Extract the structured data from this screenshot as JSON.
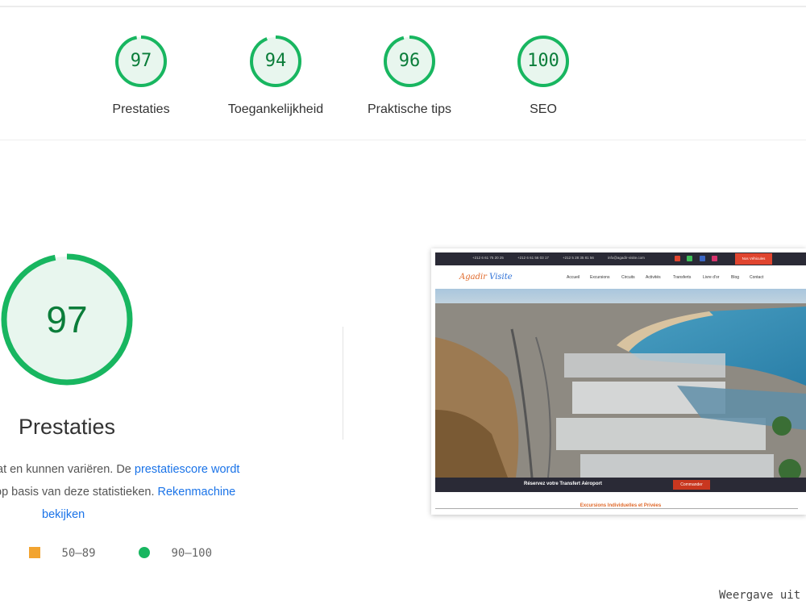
{
  "summary_gauges": [
    {
      "score": "97",
      "label": "Prestaties",
      "color": "#18b660"
    },
    {
      "score": "94",
      "label": "Toegankelijkheid",
      "color": "#18b660"
    },
    {
      "score": "96",
      "label": "Praktische tips",
      "color": "#18b660"
    },
    {
      "score": "100",
      "label": "SEO",
      "color": "#18b660"
    }
  ],
  "detail": {
    "score": "97",
    "title": "Prestaties",
    "desc_line1_text": "at en kunnen variëren. De ",
    "desc_line1_link": "prestatiescore wordt",
    "desc_line2_text": "op basis van deze statistieken. ",
    "desc_line2_link": "Rekenmachine",
    "desc_line3_link": "bekijken"
  },
  "legend": {
    "mid_range": "50–89",
    "good_range": "90–100"
  },
  "screenshot": {
    "topbar": {
      "phone1": "+212 6 61 75 20 25",
      "phone2": "+212 6 61 56 03 17",
      "phone3": "+212 5 28 35 81 56",
      "email": "info@agadir-visite.com",
      "cta": "Nos Véhicules"
    },
    "logo_part1": "Agadir",
    "logo_part2": "Visite",
    "nav": {
      "accueil": "Accueil",
      "excursions": "Excursions",
      "circuits": "Circuits",
      "activites": "Activités",
      "transferts": "Transferts",
      "livre": "Livre d'or",
      "blog": "Blog",
      "contact": "Contact"
    },
    "booking_text": "Réservez votre Transfert Aéroport",
    "booking_button": "Commander",
    "subheading": "Excursions Individuelles et Privées"
  },
  "view_link": "Weergave uit"
}
